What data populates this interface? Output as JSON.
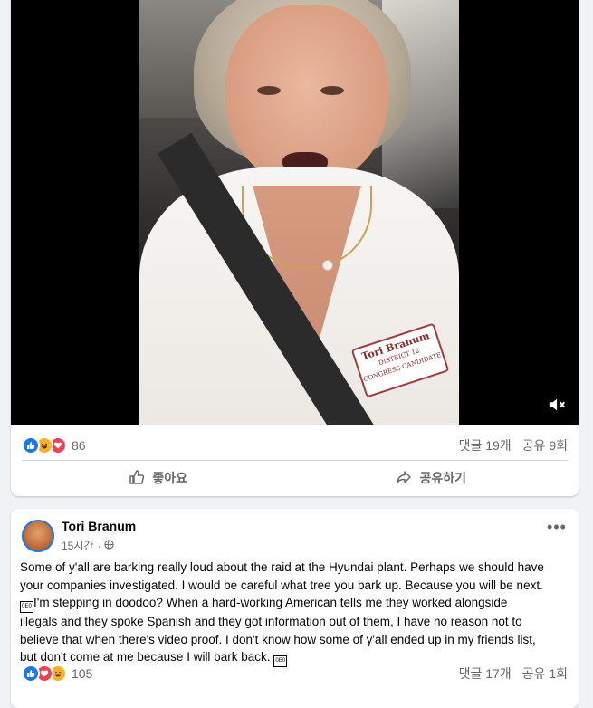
{
  "post1": {
    "video": {
      "badge_line1": "Tori Branum",
      "badge_line2": "DISTRICT 12",
      "badge_line3": "CONGRESS CANDIDATE",
      "mute_icon": "volume-muted-icon"
    },
    "reaction_count": "86",
    "comments": "댓글 19개",
    "shares": "공유 9회",
    "like_label": "좋아요",
    "share_label": "공유하기"
  },
  "post2": {
    "author": "Tori Branum",
    "time": "15시간",
    "privacy_icon": "globe-icon",
    "body_lines": [
      "Some of y'all are barking really loud about the raid at the Hyundai plant. Perhaps we should have",
      "your companies investigated. I would be careful what tree you bark up. Because you will be next.",
      "I'm stepping in doodoo?  When a  hard-working American tells me they worked alongside",
      "illegals and they spoke Spanish and they got information out of them, I have no reason not to",
      "believe that when there's video proof. I don't know how some of y'all ended up in  my friends list,",
      "but don't come at me because I will bark back."
    ],
    "emoji_placeholder": "0E0",
    "reaction_count": "105",
    "comments": "댓글 17개",
    "shares": "공유 1회"
  },
  "colors": {
    "like_blue": "#1877f2",
    "love_red": "#f33e58",
    "haha_yellow": "#f7b125",
    "muted_text": "#65676b"
  }
}
